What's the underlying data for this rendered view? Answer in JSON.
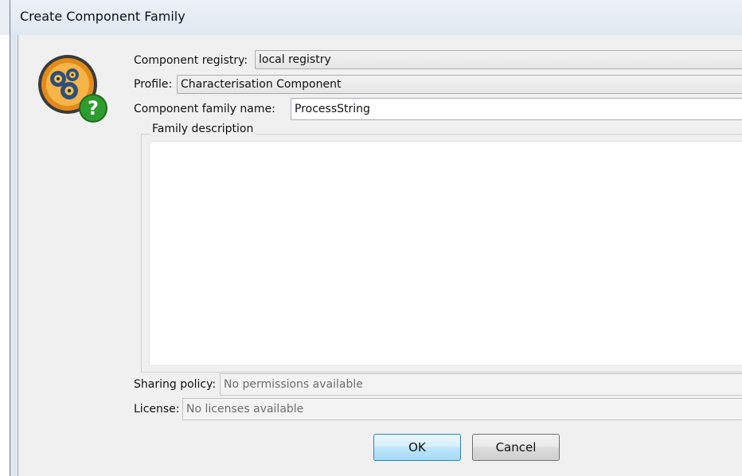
{
  "window": {
    "title": "Create Component Family"
  },
  "icon": {
    "name": "component-family-help-icon",
    "colors": {
      "gear": "#e38b1a",
      "ring": "#3a3a3a",
      "badge": "#2e9b2e"
    }
  },
  "form": {
    "registry_label": "Component registry:",
    "registry_value": "local registry",
    "profile_label": "Profile:",
    "profile_value": "Characterisation Component",
    "family_name_label": "Component family name:",
    "family_name_value": "ProcessString",
    "description_legend": "Family description",
    "description_value": "",
    "sharing_label": "Sharing policy:",
    "sharing_value": "No permissions available",
    "license_label": "License:",
    "license_value": "No licenses available"
  },
  "buttons": {
    "ok": "OK",
    "cancel": "Cancel"
  }
}
